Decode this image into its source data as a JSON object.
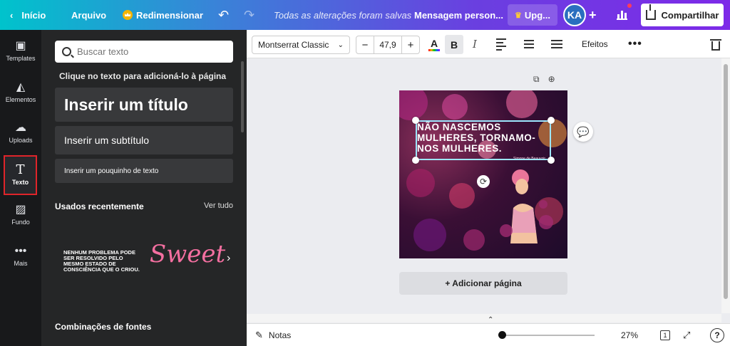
{
  "topbar": {
    "back_label": "Início",
    "arquivo_label": "Arquivo",
    "redimensionar_label": "Redimensionar",
    "saved_status": "Todas as alterações foram salvas",
    "design_name": "Mensagem person...",
    "upgrade_label": "Upg...",
    "avatar_initials": "KA",
    "share_label": "Compartilhar"
  },
  "rail": {
    "items": [
      {
        "label": "Templates",
        "icon": "templates-icon"
      },
      {
        "label": "Elementos",
        "icon": "elements-icon"
      },
      {
        "label": "Uploads",
        "icon": "upload-icon"
      },
      {
        "label": "Texto",
        "icon": "text-icon",
        "active": true
      },
      {
        "label": "Fundo",
        "icon": "background-icon"
      },
      {
        "label": "Mais",
        "icon": "more-icon"
      }
    ]
  },
  "panel": {
    "search_placeholder": "Buscar texto",
    "hint": "Clique no texto para adicioná-lo à página",
    "add_title": "Inserir um título",
    "add_subtitle": "Inserir um subtítulo",
    "add_body": "Inserir um pouquinho de texto",
    "recent_heading": "Usados recentemente",
    "see_all": "Ver tudo",
    "recent_1": "NENHUM PROBLEMA PODE SER RESOLVIDO PELO MESMO ESTADO DE CONSCIÊNCIA QUE O CRIOU.",
    "recent_2": "Sweet",
    "combos_heading": "Combinações de fontes"
  },
  "toolbar": {
    "font_name": "Montserrat Classic",
    "font_size": "47,9",
    "minus": "−",
    "plus": "+",
    "color_letter": "A",
    "bold": "B",
    "italic": "I",
    "effects": "Efeitos",
    "more": "•••"
  },
  "canvas": {
    "quote": "NÃO NASCEMOS MULHERES, TORNAMO-NOS MULHERES.",
    "quote_author": "Simone de Beauvoir",
    "add_page": "+ Adicionar página"
  },
  "bottombar": {
    "notes": "Notas",
    "zoom": "27%",
    "zoom_level": 0.27,
    "pages_count": "1",
    "help": "?"
  },
  "colors": {
    "accent_gradient_start": "#00c3cc",
    "accent_gradient_end": "#7d2ae8",
    "active_outline": "#e0242a",
    "panel_bg": "#252627",
    "rail_bg": "#18191b"
  }
}
